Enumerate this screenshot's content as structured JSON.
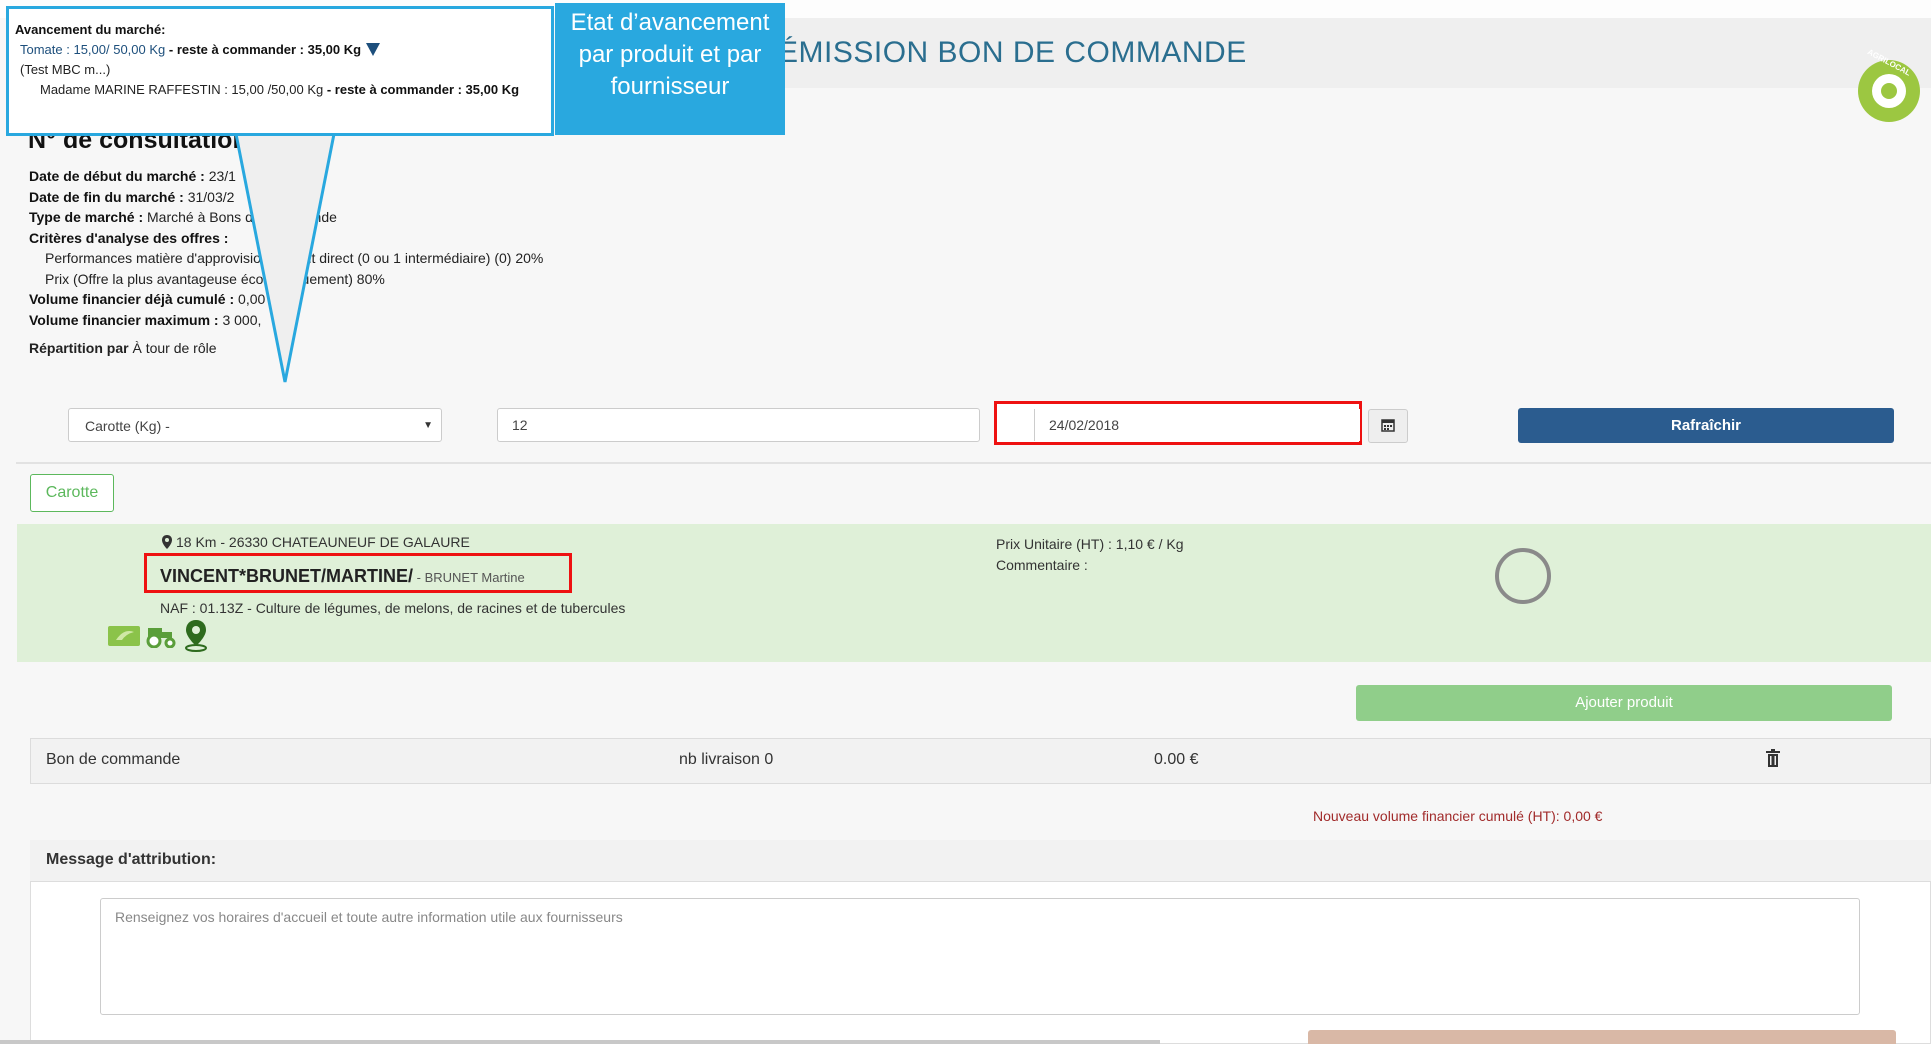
{
  "header": {
    "title": "ÉMISSION BON DE COMMANDE",
    "logo_text": "AGRILOCAL"
  },
  "consultation": {
    "title": "N° de consultation",
    "start_label": "Date de début du marché :",
    "start_value": "23/1",
    "end_label": "Date de fin du marché :",
    "end_value": "31/03/2",
    "type_label": "Type de marché :",
    "type_value": "Marché à Bons de Commande",
    "criteria_label": "Critères d'analyse des offres :",
    "criteria_1": "Performances matière d'approvisionnement direct (0 ou 1 intermédiaire) (0) 20%",
    "criteria_2": "Prix (Offre la plus avantageuse économiquement) 80%",
    "cumulated_label": "Volume financier déjà cumulé :",
    "cumulated_value": "0,00",
    "max_label": "Volume financier maximum :",
    "max_value": "3 000,",
    "repartition_label": "Répartition par",
    "repartition_value": "À tour de rôle"
  },
  "filters": {
    "product_select": "Carotte (Kg) -",
    "quantity": "12",
    "date": "24/02/2018",
    "refresh_label": "Rafraîchir"
  },
  "product_tab": "Carotte",
  "supplier": {
    "distance": "18 Km  -  26330 CHATEAUNEUF DE GALAURE",
    "name": "VINCENT*BRUNET/MARTINE/",
    "contact": " - BRUNET Martine",
    "naf": "NAF : 01.13Z - Culture de légumes, de melons, de racines et de tubercules",
    "price": "Prix Unitaire (HT) : 1,10 € / Kg",
    "comment": "Commentaire :",
    "badges": [
      "bio-icon",
      "tractor-icon",
      "map-pin-icon"
    ]
  },
  "add_product_label": "Ajouter produit",
  "order": {
    "label": "Bon de commande",
    "delivery": "nb livraison 0",
    "total": "0.00 €"
  },
  "new_volume": "Nouveau volume financier cumulé (HT): 0,00 €",
  "message": {
    "title": "Message d'attribution:",
    "placeholder": "Renseignez vos horaires d'accueil et toute autre information utile aux fournisseurs"
  },
  "callout": {
    "title": "Avancement du marché:",
    "line1_product": "Tomate   :  15,00/ 50,00 Kg",
    "line1_remaining": " - reste à commander : 35,00 Kg",
    "line2": "(Test MBC m...)",
    "line3_name": "Madame MARINE RAFFESTIN : 15,00 /50,00 Kg",
    "line3_remaining": "  - reste à commander : 35,00  Kg",
    "label": "Etat d’avancement par produit et par fournisseur"
  },
  "colors": {
    "accent_blue": "#2b5c8f",
    "callout_blue": "#29a8df",
    "panel_green": "#dff0d8",
    "highlight_red": "#e11111"
  }
}
